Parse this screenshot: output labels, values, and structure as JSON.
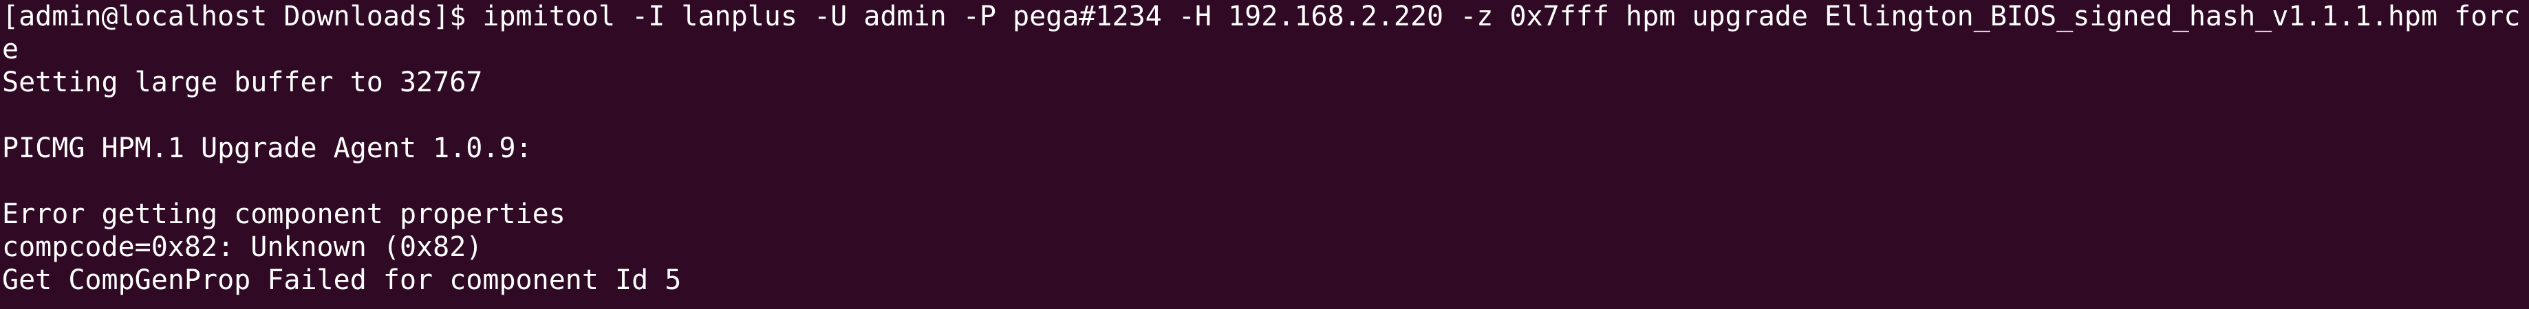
{
  "terminal": {
    "lines": [
      "[admin@localhost Downloads]$ ipmitool -I lanplus -U admin -P pega#1234 -H 192.168.2.220 -z 0x7fff hpm upgrade Ellington_BIOS_signed_hash_v1.1.1.hpm forc",
      "e",
      "Setting large buffer to 32767",
      "",
      "PICMG HPM.1 Upgrade Agent 1.0.9:",
      "",
      "Error getting component properties",
      "compcode=0x82: Unknown (0x82)",
      "Get CompGenProp Failed for component Id 5"
    ]
  },
  "colors": {
    "background": "#300a24",
    "foreground": "#ffffff"
  }
}
